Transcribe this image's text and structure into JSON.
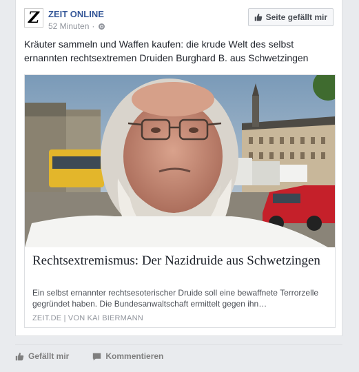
{
  "post": {
    "page_name": "ZEIT ONLINE",
    "avatar_letter": "Z",
    "timestamp": "52 Minuten",
    "meta_separator": "·",
    "like_page_label": "Seite gefällt mir",
    "text": "Kräuter sammeln und Waffen kaufen: die krude Welt des selbst ernannten rechtsextremen Druiden Burghard B. aus Schwetzingen"
  },
  "link": {
    "title": "Rechtsextremismus: Der Nazidruide aus Schwetzingen",
    "description": "Ein selbst ernannter rechtsesoterischer Druide soll eine bewaffnete Terrorzelle gegründet haben. Die Bundesanwaltschaft ermittelt gegen ihn…",
    "source": "ZEIT.DE  |  VON KAI BIERMANN"
  },
  "actions": {
    "like_label": "Gefällt mir",
    "comment_label": "Kommentieren"
  },
  "icons": {
    "like_page": "thumbs-up-icon",
    "privacy": "globe-icon",
    "like": "thumbs-up-icon",
    "comment": "speech-bubble-icon"
  },
  "colors": {
    "page_name": "#365899",
    "meta": "#90949c",
    "background": "#e9ebee"
  }
}
